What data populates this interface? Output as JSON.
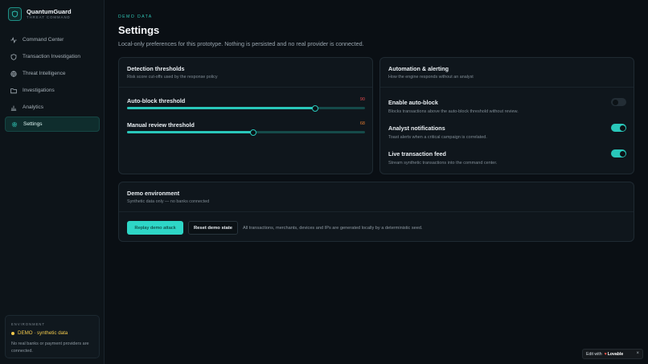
{
  "brand": {
    "name": "QuantumGuard",
    "subtitle": "THREAT COMMAND"
  },
  "sidebar": {
    "items": [
      {
        "label": "Command Center",
        "icon": "activity-icon",
        "active": false
      },
      {
        "label": "Transaction Investigation",
        "icon": "shield-icon",
        "active": false
      },
      {
        "label": "Threat Intelligence",
        "icon": "globe-icon",
        "active": false
      },
      {
        "label": "Investigations",
        "icon": "folder-icon",
        "active": false
      },
      {
        "label": "Analytics",
        "icon": "bar-chart-icon",
        "active": false
      },
      {
        "label": "Settings",
        "icon": "gear-icon",
        "active": true
      }
    ],
    "environment": {
      "label": "ENVIRONMENT",
      "status": "DEMO · synthetic data",
      "note": "No real banks or payment providers are connected."
    }
  },
  "header": {
    "eyebrow": "DEMO DATA",
    "title": "Settings",
    "description": "Local-only preferences for this prototype. Nothing is persisted and no real provider is connected."
  },
  "detection": {
    "title": "Detection thresholds",
    "subtitle": "Risk score cut-offs used by the response policy",
    "sliders": [
      {
        "label": "Auto-block threshold",
        "value": "90",
        "fraction": 0.79,
        "color": "#e5484d"
      },
      {
        "label": "Manual review threshold",
        "value": "68",
        "fraction": 0.53,
        "color": "#e07a2f"
      }
    ]
  },
  "automation": {
    "title": "Automation & alerting",
    "subtitle": "How the engine responds without an analyst",
    "toggles": [
      {
        "title": "Enable auto-block",
        "desc": "Blocks transactions above the auto-block threshold without review.",
        "on": false
      },
      {
        "title": "Analyst notifications",
        "desc": "Toast alerts when a critical campaign is correlated.",
        "on": true
      },
      {
        "title": "Live transaction feed",
        "desc": "Stream synthetic transactions into the command center.",
        "on": true
      }
    ]
  },
  "demo": {
    "title": "Demo environment",
    "subtitle": "Synthetic data only — no banks connected",
    "replay_label": "Replay demo attack",
    "reset_label": "Reset demo state",
    "note": "All transactions, merchants, devices and IPs are generated locally by a deterministic seed."
  },
  "badge": {
    "prefix": "Edit with",
    "brand": "Lovable",
    "close": "×"
  },
  "colors": {
    "accent": "#29c7ba",
    "warning": "#f2c94c"
  }
}
